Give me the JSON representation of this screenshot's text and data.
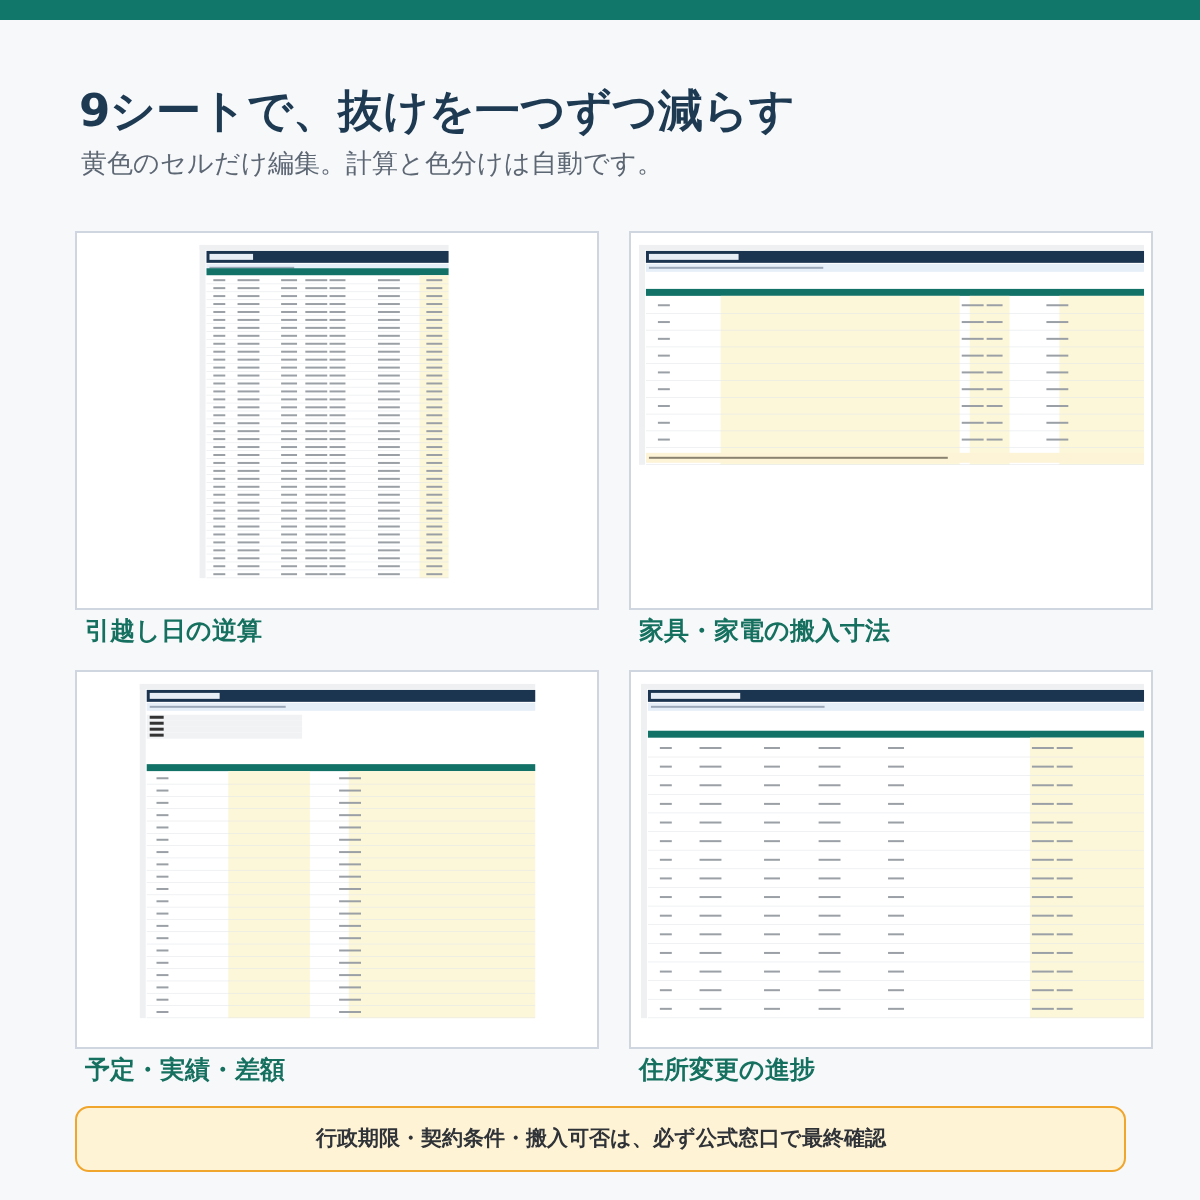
{
  "heading": "9シートで、抜けを一つずつ減らす",
  "subheading": "黄色のセルだけ編集。計算と色分けは自動です。",
  "cards": [
    {
      "caption": "引越し日の逆算"
    },
    {
      "caption": "家具・家電の搬入寸法"
    },
    {
      "caption": "予定・実績・差額"
    },
    {
      "caption": "住所変更の進捗"
    }
  ],
  "notice": "行政期限・契約条件・搬入可否は、必ず公式窓口で最終確認"
}
